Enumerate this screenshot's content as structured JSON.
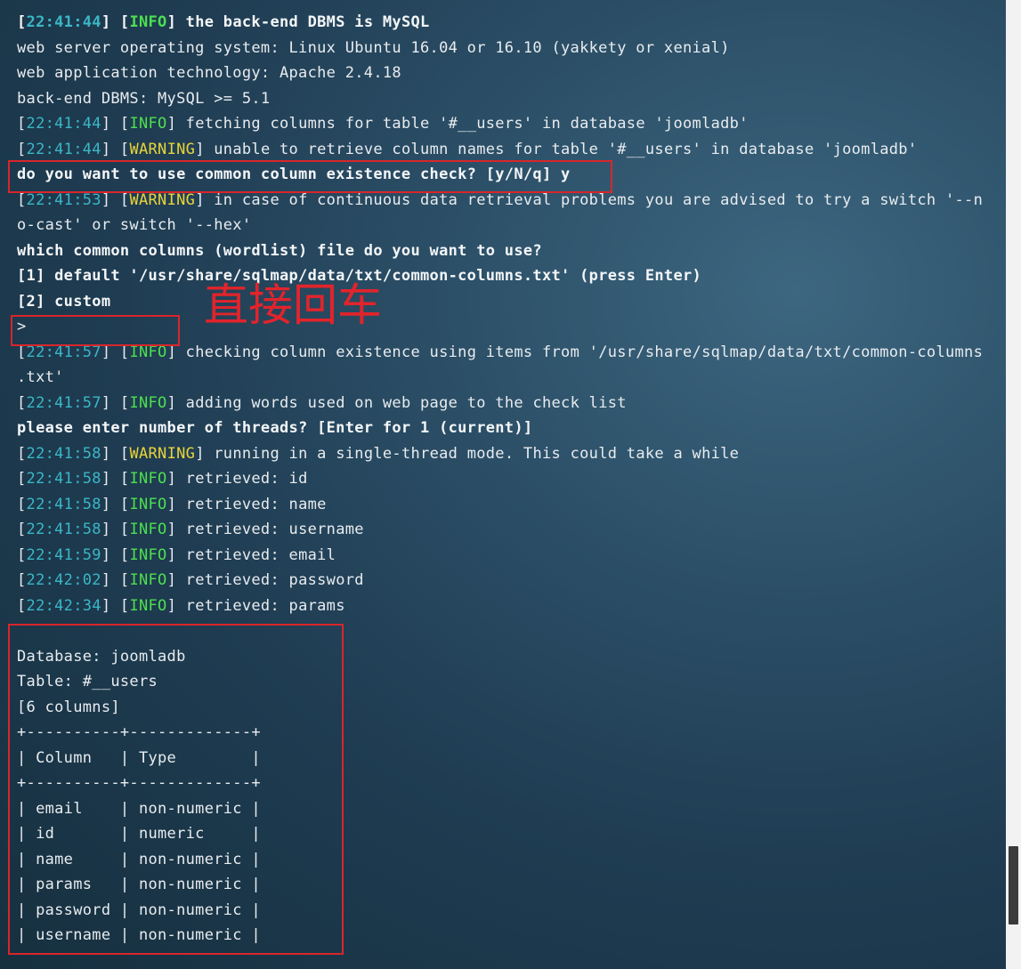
{
  "terminal": {
    "top_fragment": "...",
    "lines": [
      {
        "ts": "22:41:44",
        "level": "INFO",
        "msg": "the back-end DBMS is MySQL",
        "bold": true
      },
      {
        "text": "web server operating system: Linux Ubuntu 16.04 or 16.10 (yakkety or xenial)"
      },
      {
        "text": "web application technology: Apache 2.4.18"
      },
      {
        "text": "back-end DBMS: MySQL >= 5.1"
      },
      {
        "ts": "22:41:44",
        "level": "INFO",
        "msg": "fetching columns for table '#__users' in database 'joomladb'"
      },
      {
        "ts": "22:41:44",
        "level": "WARNING",
        "msg": "unable to retrieve column names for table '#__users' in database 'joomladb'"
      },
      {
        "text": "do you want to use common column existence check? [y/N/q] y",
        "bold": true
      },
      {
        "ts": "22:41:53",
        "level": "WARNING",
        "msg": "in case of continuous data retrieval problems you are advised to try a switch '--n"
      },
      {
        "text": "o-cast' or switch '--hex'"
      },
      {
        "text": "which common columns (wordlist) file do you want to use?",
        "bold": true
      },
      {
        "text": "[1] default '/usr/share/sqlmap/data/txt/common-columns.txt' (press Enter)",
        "bold": true
      },
      {
        "text": "[2] custom",
        "bold": true
      },
      {
        "text": ">"
      },
      {
        "ts": "22:41:57",
        "level": "INFO",
        "msg": "checking column existence using items from '/usr/share/sqlmap/data/txt/common-columns"
      },
      {
        "text": ".txt'"
      },
      {
        "ts": "22:41:57",
        "level": "INFO",
        "msg": "adding words used on web page to the check list"
      },
      {
        "text": "please enter number of threads? [Enter for 1 (current)]",
        "bold": true
      },
      {
        "ts": "22:41:58",
        "level": "WARNING",
        "msg": "running in a single-thread mode. This could take a while"
      },
      {
        "ts": "22:41:58",
        "level": "INFO",
        "msg": "retrieved: id"
      },
      {
        "ts": "22:41:58",
        "level": "INFO",
        "msg": "retrieved: name"
      },
      {
        "ts": "22:41:58",
        "level": "INFO",
        "msg": "retrieved: username"
      },
      {
        "ts": "22:41:59",
        "level": "INFO",
        "msg": "retrieved: email"
      },
      {
        "ts": "22:42:02",
        "level": "INFO",
        "msg": "retrieved: password"
      },
      {
        "ts": "22:42:34",
        "level": "INFO",
        "msg": "retrieved: params"
      },
      {
        "text": ""
      },
      {
        "text": "Database: joomladb"
      },
      {
        "text": "Table: #__users"
      },
      {
        "text": "[6 columns]"
      },
      {
        "text": "+----------+-------------+"
      },
      {
        "text": "| Column   | Type        |"
      },
      {
        "text": "+----------+-------------+"
      },
      {
        "text": "| email    | non-numeric |"
      },
      {
        "text": "| id       | numeric     |"
      },
      {
        "text": "| name     | non-numeric |"
      },
      {
        "text": "| params   | non-numeric |"
      },
      {
        "text": "| password | non-numeric |"
      },
      {
        "text": "| username | non-numeric |"
      }
    ]
  },
  "annotation": {
    "label": "直接回车"
  },
  "colors": {
    "timestamp": "#3ab7c6",
    "info": "#4de04f",
    "warning": "#e8d43a",
    "highlight_box": "#d8262b",
    "annotation_text": "#e2242b"
  },
  "scrollbar": {
    "position": 0.95
  }
}
